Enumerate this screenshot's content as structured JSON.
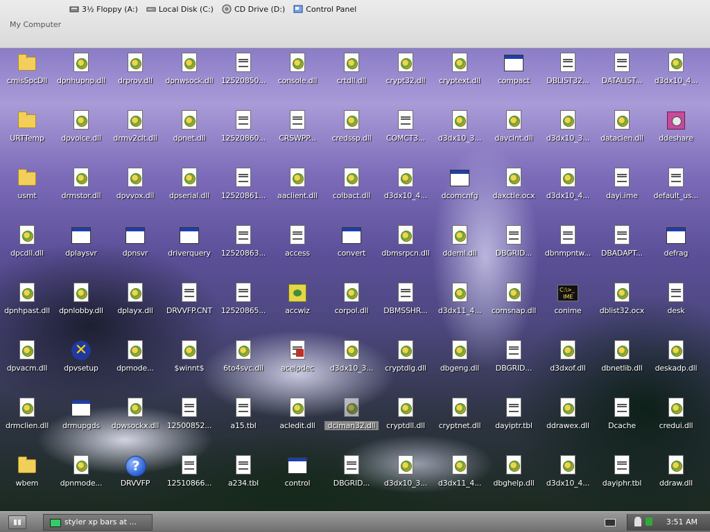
{
  "explorer_bar": {
    "location_title": "My Computer",
    "drives": [
      {
        "label": "3½ Floppy (A:)",
        "icon": "floppy-drive-icon"
      },
      {
        "label": "Local Disk (C:)",
        "icon": "hard-disk-icon"
      },
      {
        "label": "CD Drive (D:)",
        "icon": "cd-drive-icon"
      },
      {
        "label": "Control Panel",
        "icon": "control-panel-icon"
      }
    ]
  },
  "desktop": {
    "columns": [
      [
        "cmisSpcDll",
        "URTTemp",
        "usmt",
        "dpcdll.dll",
        "dpnhpast.dll",
        "dpvacm.dll",
        "drmclien.dll",
        "wbem"
      ],
      [
        "dpnhupnp.dll",
        "dpvoice.dll",
        "drmstor.dll",
        "dplaysvr",
        "dpnlobby.dll",
        "dpvsetup",
        "drmupgds",
        "dpnmode..."
      ],
      [
        "drprov.dll",
        "drmv2clt.dll",
        "dpvvox.dll",
        "dpnsvr",
        "dplayx.dll",
        "dpmode...",
        "dpwsockx.dll",
        "DRVVFP"
      ],
      [
        "dpnwsock.dll",
        "dpnet.dll",
        "dpserial.dll",
        "driverquery",
        "DRVVFP.CNT",
        "$winnt$",
        "12500852...",
        "12510866..."
      ],
      [
        "12520850...",
        "12520860...",
        "12520861...",
        "12520863...",
        "12520865...",
        "6to4svc.dll",
        "a15.tbl",
        "a234.tbl"
      ],
      [
        "console.dll",
        "CRSWPP...",
        "aaclient.dll",
        "access",
        "accwiz",
        "acelpdec",
        "acledit.dll",
        "control"
      ],
      [
        "crtdll.dll",
        "credssp.dll",
        "colbact.dll",
        "convert",
        "corpol.dll",
        "d3dx10_3...",
        "dciman32.dll",
        "DBGRID..."
      ],
      [
        "crypt32.dll",
        "COMCT3...",
        "d3dx10_4...",
        "dbmsrpcn.dll",
        "DBMSSHR...",
        "cryptdlg.dll",
        "cryptdll.dll",
        "d3dx10_3..."
      ],
      [
        "cryptext.dll",
        "d3dx10_3...",
        "dcomcnfg",
        "ddeml.dll",
        "d3dx11_4...",
        "dbgeng.dll",
        "cryptnet.dll",
        "d3dx11_4..."
      ],
      [
        "compact",
        "davclnt.dll",
        "daxctle.ocx",
        "DBGRID...",
        "comsnap.dll",
        "DBGRID...",
        "dayiptr.tbl",
        "dbghelp.dll"
      ],
      [
        "DBLIST32...",
        "d3dx10_3...",
        "d3dx10_4...",
        "dbnmpntw...",
        "conime",
        "d3dxof.dll",
        "ddrawex.dll",
        "d3dx10_4..."
      ],
      [
        "DATALIST...",
        "dataclen.dll",
        "dayi.ime",
        "DBADAPT...",
        "dblist32.ocx",
        "dbnetlib.dll",
        "Dcache",
        "dayiphr.tbl"
      ],
      [
        "d3dx10_4...",
        "ddeshare",
        "default_us...",
        "defrag",
        "desk",
        "deskadp.dll",
        "credui.dll",
        "ddraw.dll"
      ]
    ],
    "selected_item": "dciman32.dll"
  },
  "taskbar": {
    "task_item_label": "styler xp bars at ...",
    "clock": "3:51 AM"
  }
}
